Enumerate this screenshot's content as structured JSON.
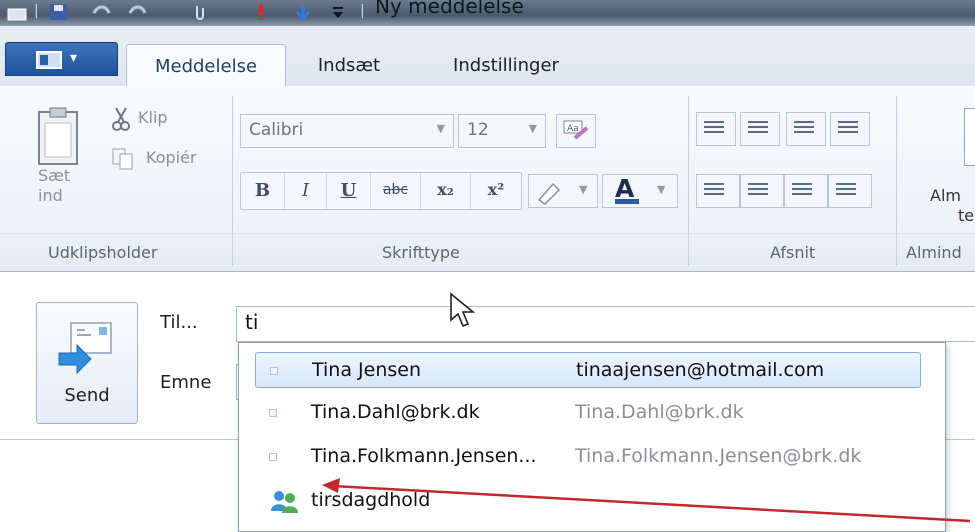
{
  "window": {
    "title": "Ny meddelelse"
  },
  "tabs": [
    {
      "label": "Meddelelse",
      "active": true
    },
    {
      "label": "Indsæt",
      "active": false
    },
    {
      "label": "Indstillinger",
      "active": false
    }
  ],
  "ribbon": {
    "clipboard": {
      "paste_label": "Sæt ind",
      "paste_line1": "Sæt",
      "paste_line2": "ind",
      "cut_label": "Klip",
      "copy_label": "Kopiér",
      "group_label": "Udklipsholder"
    },
    "font": {
      "font_name": "Calibri",
      "font_size": "12",
      "group_label": "Skrifttype",
      "buttons": [
        "B",
        "I",
        "U",
        "abc",
        "x₂",
        "x²"
      ]
    },
    "paragraph": {
      "group_label": "Afsnit"
    },
    "common": {
      "label_line1": "Alm",
      "label_line2": "te",
      "group_label": "Almind"
    }
  },
  "compose": {
    "send_label": "Send",
    "to_label": "Til...",
    "subject_label": "Emne",
    "to_value": "ti"
  },
  "autocomplete": [
    {
      "name": "Tina Jensen",
      "email": "tinaajensen@hotmail.com",
      "selected": true,
      "type": "contact"
    },
    {
      "name": "Tina.Dahl@brk.dk",
      "email": "Tina.Dahl@brk.dk",
      "selected": false,
      "type": "contact"
    },
    {
      "name": "Tina.Folkmann.Jensen...",
      "email": "Tina.Folkmann.Jensen@brk.dk",
      "selected": false,
      "type": "contact"
    },
    {
      "name": "tirsdagdhold",
      "email": "",
      "selected": false,
      "type": "group"
    }
  ],
  "colors": {
    "accent": "#1d54a0",
    "annotation_arrow": "#c0282d",
    "selection": "#d7e7fa"
  }
}
